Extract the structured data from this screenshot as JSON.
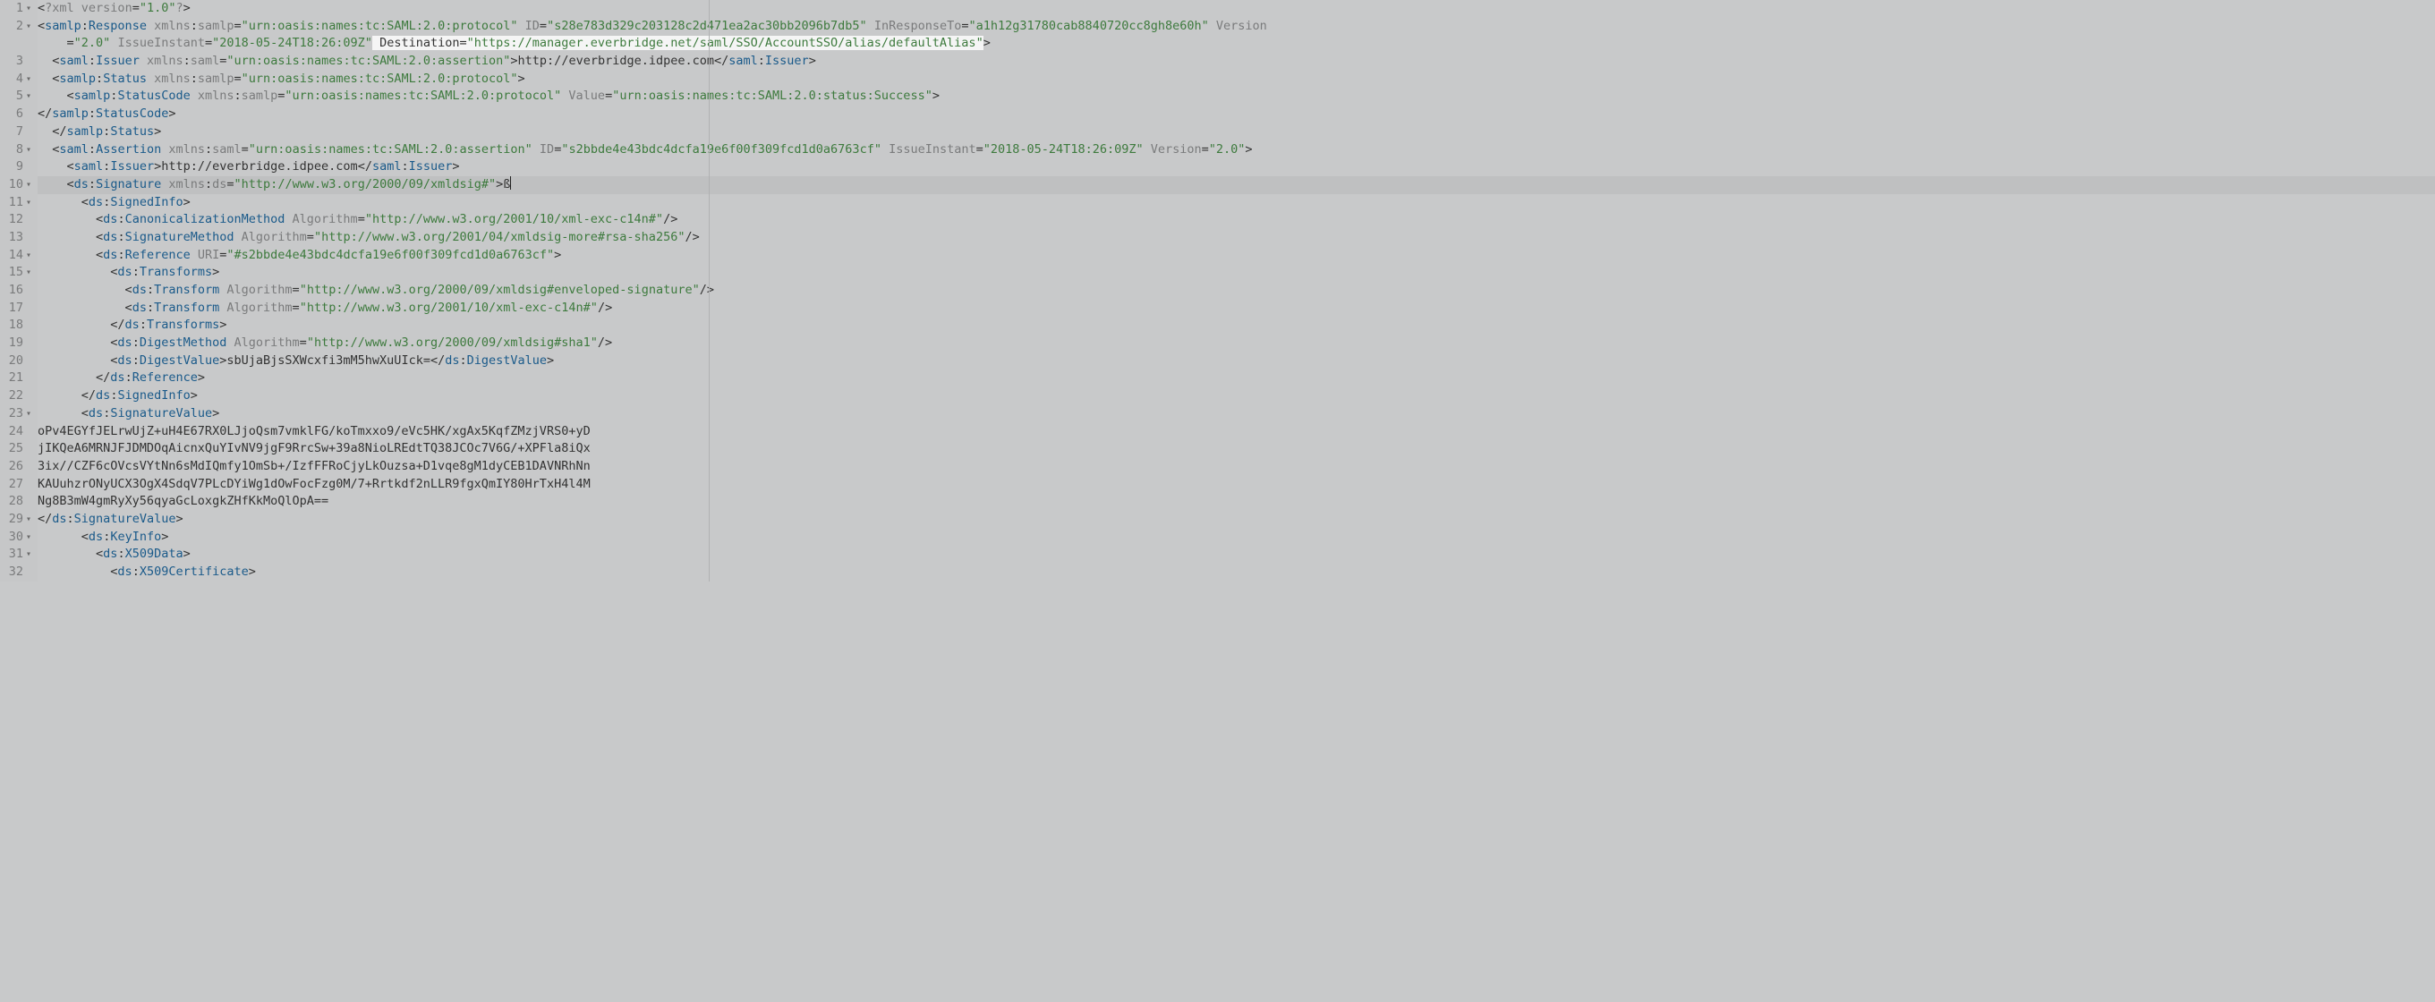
{
  "editor": {
    "line_count": 32,
    "fold_marks": [
      1,
      2,
      4,
      5,
      8,
      10,
      11,
      14,
      15,
      23,
      29,
      30,
      31
    ],
    "current_line": 10,
    "highlight_text": " Destination=\"https://manager.everbridge.net/saml/SSO/AccountSSO/alias/defaultAlias\""
  },
  "colors": {
    "tag": "#1a5a8a",
    "attr": "#7a7b7c",
    "val": "#3d7a3d",
    "bg": "#c8c9ca",
    "highlight_bg": "#f5f5f5"
  },
  "lines": [
    {
      "n": 1,
      "indent": "",
      "tokens": [
        [
          "punct",
          "<"
        ],
        [
          "pi",
          "?xml"
        ],
        [
          "punct",
          " "
        ],
        [
          "attr",
          "version"
        ],
        [
          "punct",
          "="
        ],
        [
          "val",
          "\"1.0\""
        ],
        [
          "pi",
          "?"
        ],
        [
          "punct",
          ">"
        ]
      ]
    },
    {
      "n": 2,
      "indent": "",
      "tokens": [
        [
          "punct",
          "<"
        ],
        [
          "tag",
          "samlp"
        ],
        [
          "punct",
          ":"
        ],
        [
          "tag",
          "Response"
        ],
        [
          "punct",
          " "
        ],
        [
          "attr",
          "xmlns"
        ],
        [
          "punct",
          ":"
        ],
        [
          "attr",
          "samlp"
        ],
        [
          "punct",
          "="
        ],
        [
          "val",
          "\"urn:oasis:names:tc:SAML:2.0:protocol\""
        ],
        [
          "punct",
          " "
        ],
        [
          "attr",
          "ID"
        ],
        [
          "punct",
          "="
        ],
        [
          "val",
          "\"s28e783d329c203128c2d471ea2ac30bb2096b7db5\""
        ],
        [
          "punct",
          " "
        ],
        [
          "attr",
          "InResponseTo"
        ],
        [
          "punct",
          "="
        ],
        [
          "val",
          "\"a1h12g31780cab8840720cc8gh8e60h\""
        ],
        [
          "punct",
          " "
        ],
        [
          "attr",
          "Version"
        ]
      ]
    },
    {
      "n": "2b",
      "indent": "    ",
      "tokens": [
        [
          "punct",
          "="
        ],
        [
          "val",
          "\"2.0\""
        ],
        [
          "punct",
          " "
        ],
        [
          "attr",
          "IssueInstant"
        ],
        [
          "punct",
          "="
        ],
        [
          "val",
          "\"2018-05-24T18:26:09Z\""
        ],
        [
          "hlstart",
          ""
        ],
        [
          "punct",
          " "
        ],
        [
          "attr-dark",
          "Destination"
        ],
        [
          "punct",
          "="
        ],
        [
          "val",
          "\"https://manager.everbridge.net/saml/SSO/AccountSSO/alias/defaultAlias\""
        ],
        [
          "hlend",
          ""
        ],
        [
          "punct",
          ">"
        ]
      ]
    },
    {
      "n": 3,
      "indent": "  ",
      "tokens": [
        [
          "punct",
          "<"
        ],
        [
          "tag",
          "saml"
        ],
        [
          "punct",
          ":"
        ],
        [
          "tag",
          "Issuer"
        ],
        [
          "punct",
          " "
        ],
        [
          "attr",
          "xmlns"
        ],
        [
          "punct",
          ":"
        ],
        [
          "attr",
          "saml"
        ],
        [
          "punct",
          "="
        ],
        [
          "val",
          "\"urn:oasis:names:tc:SAML:2.0:assertion\""
        ],
        [
          "punct",
          ">"
        ],
        [
          "punct",
          "http://everbridge.idpee.com"
        ],
        [
          "punct",
          "</"
        ],
        [
          "tag",
          "saml"
        ],
        [
          "punct",
          ":"
        ],
        [
          "tag",
          "Issuer"
        ],
        [
          "punct",
          ">"
        ]
      ]
    },
    {
      "n": 4,
      "indent": "  ",
      "tokens": [
        [
          "punct",
          "<"
        ],
        [
          "tag",
          "samlp"
        ],
        [
          "punct",
          ":"
        ],
        [
          "tag",
          "Status"
        ],
        [
          "punct",
          " "
        ],
        [
          "attr",
          "xmlns"
        ],
        [
          "punct",
          ":"
        ],
        [
          "attr",
          "samlp"
        ],
        [
          "punct",
          "="
        ],
        [
          "val",
          "\"urn:oasis:names:tc:SAML:2.0:protocol\""
        ],
        [
          "punct",
          ">"
        ]
      ]
    },
    {
      "n": 5,
      "indent": "    ",
      "tokens": [
        [
          "punct",
          "<"
        ],
        [
          "tag",
          "samlp"
        ],
        [
          "punct",
          ":"
        ],
        [
          "tag",
          "StatusCode"
        ],
        [
          "punct",
          " "
        ],
        [
          "attr",
          "xmlns"
        ],
        [
          "punct",
          ":"
        ],
        [
          "attr",
          "samlp"
        ],
        [
          "punct",
          "="
        ],
        [
          "val",
          "\"urn:oasis:names:tc:SAML:2.0:protocol\""
        ],
        [
          "punct",
          " "
        ],
        [
          "attr",
          "Value"
        ],
        [
          "punct",
          "="
        ],
        [
          "val",
          "\"urn:oasis:names:tc:SAML:2.0:status:Success\""
        ],
        [
          "punct",
          ">"
        ]
      ]
    },
    {
      "n": 6,
      "indent": "",
      "tokens": [
        [
          "punct",
          "</"
        ],
        [
          "tag",
          "samlp"
        ],
        [
          "punct",
          ":"
        ],
        [
          "tag",
          "StatusCode"
        ],
        [
          "punct",
          ">"
        ]
      ]
    },
    {
      "n": 7,
      "indent": "  ",
      "tokens": [
        [
          "punct",
          "</"
        ],
        [
          "tag",
          "samlp"
        ],
        [
          "punct",
          ":"
        ],
        [
          "tag",
          "Status"
        ],
        [
          "punct",
          ">"
        ]
      ]
    },
    {
      "n": 8,
      "indent": "  ",
      "tokens": [
        [
          "punct",
          "<"
        ],
        [
          "tag",
          "saml"
        ],
        [
          "punct",
          ":"
        ],
        [
          "tag",
          "Assertion"
        ],
        [
          "punct",
          " "
        ],
        [
          "attr",
          "xmlns"
        ],
        [
          "punct",
          ":"
        ],
        [
          "attr",
          "saml"
        ],
        [
          "punct",
          "="
        ],
        [
          "val",
          "\"urn:oasis:names:tc:SAML:2.0:assertion\""
        ],
        [
          "punct",
          " "
        ],
        [
          "attr",
          "ID"
        ],
        [
          "punct",
          "="
        ],
        [
          "val",
          "\"s2bbde4e43bdc4dcfa19e6f00f309fcd1d0a6763cf\""
        ],
        [
          "punct",
          " "
        ],
        [
          "attr",
          "IssueInstant"
        ],
        [
          "punct",
          "="
        ],
        [
          "val",
          "\"2018-05-24T18:26:09Z\""
        ],
        [
          "punct",
          " "
        ],
        [
          "attr",
          "Version"
        ],
        [
          "punct",
          "="
        ],
        [
          "val",
          "\"2.0\""
        ],
        [
          "punct",
          ">"
        ]
      ]
    },
    {
      "n": 9,
      "indent": "    ",
      "tokens": [
        [
          "punct",
          "<"
        ],
        [
          "tag",
          "saml"
        ],
        [
          "punct",
          ":"
        ],
        [
          "tag",
          "Issuer"
        ],
        [
          "punct",
          ">"
        ],
        [
          "punct",
          "http://everbridge.idpee.com"
        ],
        [
          "punct",
          "</"
        ],
        [
          "tag",
          "saml"
        ],
        [
          "punct",
          ":"
        ],
        [
          "tag",
          "Issuer"
        ],
        [
          "punct",
          ">"
        ]
      ]
    },
    {
      "n": 10,
      "indent": "    ",
      "tokens": [
        [
          "punct",
          "<"
        ],
        [
          "tag",
          "ds"
        ],
        [
          "punct",
          ":"
        ],
        [
          "tag",
          "Signature"
        ],
        [
          "punct",
          " "
        ],
        [
          "attr",
          "xmlns"
        ],
        [
          "punct",
          ":"
        ],
        [
          "attr",
          "ds"
        ],
        [
          "punct",
          "="
        ],
        [
          "val",
          "\"http://www.w3.org/2000/09/xmldsig#\""
        ],
        [
          "punct",
          ">"
        ],
        [
          "punct",
          "ß"
        ],
        [
          "cursor",
          ""
        ]
      ]
    },
    {
      "n": 11,
      "indent": "      ",
      "tokens": [
        [
          "punct",
          "<"
        ],
        [
          "tag",
          "ds"
        ],
        [
          "punct",
          ":"
        ],
        [
          "tag",
          "SignedInfo"
        ],
        [
          "punct",
          ">"
        ]
      ]
    },
    {
      "n": 12,
      "indent": "        ",
      "tokens": [
        [
          "punct",
          "<"
        ],
        [
          "tag",
          "ds"
        ],
        [
          "punct",
          ":"
        ],
        [
          "tag",
          "CanonicalizationMethod"
        ],
        [
          "punct",
          " "
        ],
        [
          "attr",
          "Algorithm"
        ],
        [
          "punct",
          "="
        ],
        [
          "val",
          "\"http://www.w3.org/2001/10/xml-exc-c14n#\""
        ],
        [
          "punct",
          "/>"
        ]
      ]
    },
    {
      "n": 13,
      "indent": "        ",
      "tokens": [
        [
          "punct",
          "<"
        ],
        [
          "tag",
          "ds"
        ],
        [
          "punct",
          ":"
        ],
        [
          "tag",
          "SignatureMethod"
        ],
        [
          "punct",
          " "
        ],
        [
          "attr",
          "Algorithm"
        ],
        [
          "punct",
          "="
        ],
        [
          "val",
          "\"http://www.w3.org/2001/04/xmldsig-more#rsa-sha256\""
        ],
        [
          "punct",
          "/>"
        ]
      ]
    },
    {
      "n": 14,
      "indent": "        ",
      "tokens": [
        [
          "punct",
          "<"
        ],
        [
          "tag",
          "ds"
        ],
        [
          "punct",
          ":"
        ],
        [
          "tag",
          "Reference"
        ],
        [
          "punct",
          " "
        ],
        [
          "attr",
          "URI"
        ],
        [
          "punct",
          "="
        ],
        [
          "val",
          "\"#s2bbde4e43bdc4dcfa19e6f00f309fcd1d0a6763cf\""
        ],
        [
          "punct",
          ">"
        ]
      ]
    },
    {
      "n": 15,
      "indent": "          ",
      "tokens": [
        [
          "punct",
          "<"
        ],
        [
          "tag",
          "ds"
        ],
        [
          "punct",
          ":"
        ],
        [
          "tag",
          "Transforms"
        ],
        [
          "punct",
          ">"
        ]
      ]
    },
    {
      "n": 16,
      "indent": "            ",
      "tokens": [
        [
          "punct",
          "<"
        ],
        [
          "tag",
          "ds"
        ],
        [
          "punct",
          ":"
        ],
        [
          "tag",
          "Transform"
        ],
        [
          "punct",
          " "
        ],
        [
          "attr",
          "Algorithm"
        ],
        [
          "punct",
          "="
        ],
        [
          "val",
          "\"http://www.w3.org/2000/09/xmldsig#enveloped-signature\""
        ],
        [
          "punct",
          "/>"
        ]
      ]
    },
    {
      "n": 17,
      "indent": "            ",
      "tokens": [
        [
          "punct",
          "<"
        ],
        [
          "tag",
          "ds"
        ],
        [
          "punct",
          ":"
        ],
        [
          "tag",
          "Transform"
        ],
        [
          "punct",
          " "
        ],
        [
          "attr",
          "Algorithm"
        ],
        [
          "punct",
          "="
        ],
        [
          "val",
          "\"http://www.w3.org/2001/10/xml-exc-c14n#\""
        ],
        [
          "punct",
          "/>"
        ]
      ]
    },
    {
      "n": 18,
      "indent": "          ",
      "tokens": [
        [
          "punct",
          "</"
        ],
        [
          "tag",
          "ds"
        ],
        [
          "punct",
          ":"
        ],
        [
          "tag",
          "Transforms"
        ],
        [
          "punct",
          ">"
        ]
      ]
    },
    {
      "n": 19,
      "indent": "          ",
      "tokens": [
        [
          "punct",
          "<"
        ],
        [
          "tag",
          "ds"
        ],
        [
          "punct",
          ":"
        ],
        [
          "tag",
          "DigestMethod"
        ],
        [
          "punct",
          " "
        ],
        [
          "attr",
          "Algorithm"
        ],
        [
          "punct",
          "="
        ],
        [
          "val",
          "\"http://www.w3.org/2000/09/xmldsig#sha1\""
        ],
        [
          "punct",
          "/>"
        ]
      ]
    },
    {
      "n": 20,
      "indent": "          ",
      "tokens": [
        [
          "punct",
          "<"
        ],
        [
          "tag",
          "ds"
        ],
        [
          "punct",
          ":"
        ],
        [
          "tag",
          "DigestValue"
        ],
        [
          "punct",
          ">"
        ],
        [
          "punct",
          "sbUjaBjsSXWcxfi3mM5hwXuUIck="
        ],
        [
          "punct",
          "</"
        ],
        [
          "tag",
          "ds"
        ],
        [
          "punct",
          ":"
        ],
        [
          "tag",
          "DigestValue"
        ],
        [
          "punct",
          ">"
        ]
      ]
    },
    {
      "n": 21,
      "indent": "        ",
      "tokens": [
        [
          "punct",
          "</"
        ],
        [
          "tag",
          "ds"
        ],
        [
          "punct",
          ":"
        ],
        [
          "tag",
          "Reference"
        ],
        [
          "punct",
          ">"
        ]
      ]
    },
    {
      "n": 22,
      "indent": "      ",
      "tokens": [
        [
          "punct",
          "</"
        ],
        [
          "tag",
          "ds"
        ],
        [
          "punct",
          ":"
        ],
        [
          "tag",
          "SignedInfo"
        ],
        [
          "punct",
          ">"
        ]
      ]
    },
    {
      "n": 23,
      "indent": "      ",
      "tokens": [
        [
          "punct",
          "<"
        ],
        [
          "tag",
          "ds"
        ],
        [
          "punct",
          ":"
        ],
        [
          "tag",
          "SignatureValue"
        ],
        [
          "punct",
          ">"
        ]
      ]
    },
    {
      "n": 24,
      "indent": "",
      "tokens": [
        [
          "punct",
          "oPv4EGYfJELrwUjZ+uH4E67RX0LJjoQsm7vmklFG/koTmxxo9/eVc5HK/xgAx5KqfZMzjVRS0+yD"
        ]
      ]
    },
    {
      "n": 25,
      "indent": "",
      "tokens": [
        [
          "punct",
          "jIKQeA6MRNJFJDMDOqAicnxQuYIvNV9jgF9RrcSw+39a8NioLREdtTQ38JCOc7V6G/+XPFla8iQx"
        ]
      ]
    },
    {
      "n": 26,
      "indent": "",
      "tokens": [
        [
          "punct",
          "3ix//CZF6cOVcsVYtNn6sMdIQmfy1OmSb+/IzfFFRoCjyLkOuzsa+D1vqe8gM1dyCEB1DAVNRhNn"
        ]
      ]
    },
    {
      "n": 27,
      "indent": "",
      "tokens": [
        [
          "punct",
          "KAUuhzrONyUCX3OgX4SdqV7PLcDYiWg1dOwFocFzg0M/7+Rrtkdf2nLLR9fgxQmIY80HrTxH4l4M"
        ]
      ]
    },
    {
      "n": 28,
      "indent": "",
      "tokens": [
        [
          "punct",
          "Ng8B3mW4gmRyXy56qyaGcLoxgkZHfKkMoQlOpA=="
        ]
      ]
    },
    {
      "n": 29,
      "indent": "",
      "tokens": [
        [
          "punct",
          "</"
        ],
        [
          "tag",
          "ds"
        ],
        [
          "punct",
          ":"
        ],
        [
          "tag",
          "SignatureValue"
        ],
        [
          "punct",
          ">"
        ]
      ]
    },
    {
      "n": 30,
      "indent": "      ",
      "tokens": [
        [
          "punct",
          "<"
        ],
        [
          "tag",
          "ds"
        ],
        [
          "punct",
          ":"
        ],
        [
          "tag",
          "KeyInfo"
        ],
        [
          "punct",
          ">"
        ]
      ]
    },
    {
      "n": 31,
      "indent": "        ",
      "tokens": [
        [
          "punct",
          "<"
        ],
        [
          "tag",
          "ds"
        ],
        [
          "punct",
          ":"
        ],
        [
          "tag",
          "X509Data"
        ],
        [
          "punct",
          ">"
        ]
      ]
    },
    {
      "n": 32,
      "indent": "          ",
      "tokens": [
        [
          "punct",
          "<"
        ],
        [
          "tag",
          "ds"
        ],
        [
          "punct",
          ":"
        ],
        [
          "tag",
          "X509Certificate"
        ],
        [
          "punct",
          ">"
        ]
      ]
    }
  ]
}
